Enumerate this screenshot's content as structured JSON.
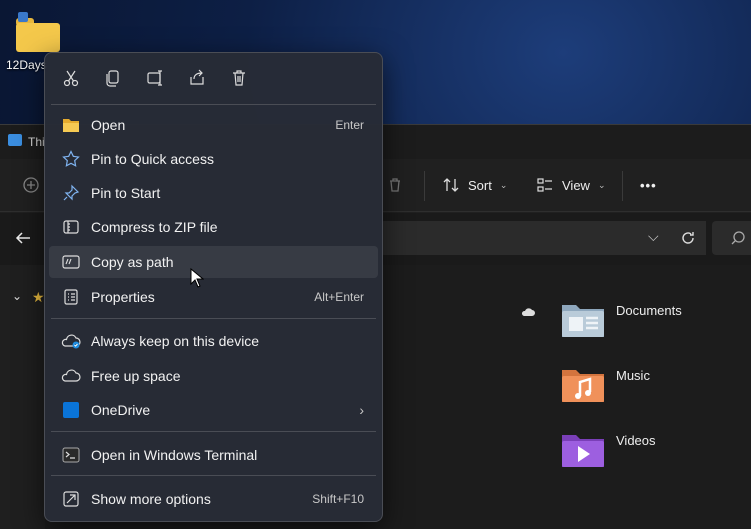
{
  "desktop": {
    "icon_label": "12Days"
  },
  "explorer": {
    "title": "Thi",
    "toolbar": {
      "sort_label": "Sort",
      "view_label": "View",
      "more_label": "•••"
    },
    "libraries": [
      {
        "label": "Documents",
        "icon": "documents-folder-icon"
      },
      {
        "label": "Music",
        "icon": "music-folder-icon"
      },
      {
        "label": "Videos",
        "icon": "videos-folder-icon"
      }
    ]
  },
  "context_menu": {
    "top_icons": [
      "cut-icon",
      "copy-icon",
      "rename-icon",
      "share-icon",
      "delete-icon"
    ],
    "items": [
      {
        "label": "Open",
        "shortcut": "Enter",
        "icon": "open-folder-icon"
      },
      {
        "label": "Pin to Quick access",
        "shortcut": "",
        "icon": "star-icon"
      },
      {
        "label": "Pin to Start",
        "shortcut": "",
        "icon": "pin-icon"
      },
      {
        "label": "Compress to ZIP file",
        "shortcut": "",
        "icon": "zip-icon"
      },
      {
        "label": "Copy as path",
        "shortcut": "",
        "icon": "copy-path-icon"
      },
      {
        "label": "Properties",
        "shortcut": "Alt+Enter",
        "icon": "properties-icon"
      },
      {
        "label": "Always keep on this device",
        "shortcut": "",
        "icon": "cloud-keep-icon"
      },
      {
        "label": "Free up space",
        "shortcut": "",
        "icon": "cloud-icon"
      },
      {
        "label": "OneDrive",
        "shortcut": "",
        "icon": "onedrive-icon"
      },
      {
        "label": "Open in Windows Terminal",
        "shortcut": "",
        "icon": "terminal-icon"
      },
      {
        "label": "Show more options",
        "shortcut": "Shift+F10",
        "icon": "more-options-icon"
      }
    ],
    "hovered_item": "Copy as path",
    "accent": "#0a74d8"
  }
}
